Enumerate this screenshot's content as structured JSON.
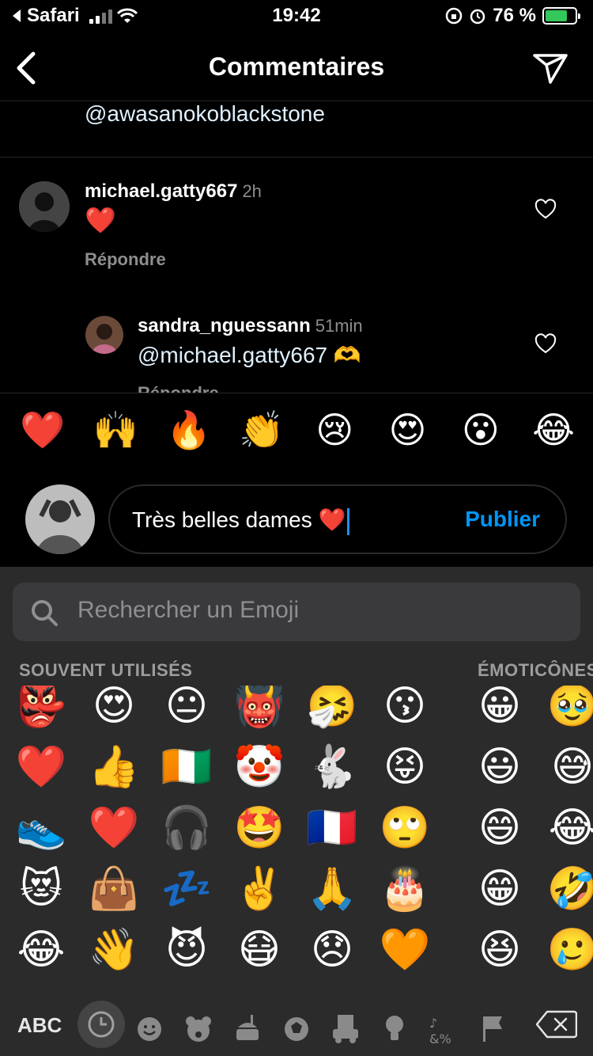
{
  "status_bar": {
    "back_app": "Safari",
    "time": "19:42",
    "battery_percent": "76 %",
    "battery_level": 0.76
  },
  "header": {
    "title": "Commentaires"
  },
  "comments": {
    "mention_top": "@awasanokoblackstone",
    "comment1": {
      "username": "michael.gatty667",
      "time": "2h",
      "text": "❤️",
      "reply_label": "Répondre"
    },
    "comment2": {
      "username": "sandra_nguessann",
      "time": "51min",
      "text": "@michael.gatty667 🫶",
      "reply_label": "Répondre"
    }
  },
  "reactions": [
    "❤️",
    "🙌",
    "🔥",
    "👏",
    "😢",
    "😍",
    "😮",
    "😂"
  ],
  "input": {
    "text": "Très belles dames ❤️",
    "publish_label": "Publier"
  },
  "keyboard": {
    "search_placeholder": "Rechercher un Emoji",
    "section_frequent": "SOUVENT UTILISÉS",
    "section_smileys": "ÉMOTICÔNES",
    "frequent_rows": [
      [
        "👺",
        "😍",
        "😐",
        "👹",
        "🤧",
        "😗"
      ],
      [
        "❤️",
        "👍",
        "🇨🇮",
        "🤡",
        "🐇",
        "😝"
      ],
      [
        "👟",
        "❤️",
        "🎧",
        "🤩",
        "🇫🇷",
        "🙄"
      ],
      [
        "😻",
        "👜",
        "💤",
        "✌️",
        "🙏",
        "🎂"
      ],
      [
        "😂",
        "👋",
        "😈",
        "😷",
        "😞",
        "🧡"
      ]
    ],
    "smiley_rows": [
      [
        "😀",
        "🥹"
      ],
      [
        "😃",
        "😅"
      ],
      [
        "😄",
        "😂"
      ],
      [
        "😁",
        "🤣"
      ],
      [
        "😆",
        "🥲"
      ]
    ],
    "abc_label": "ABC",
    "category_icons": [
      "clock-icon",
      "smiley-icon",
      "bear-icon",
      "food-icon",
      "ball-icon",
      "car-icon",
      "bulb-icon",
      "symbols-icon",
      "flag-icon"
    ]
  }
}
